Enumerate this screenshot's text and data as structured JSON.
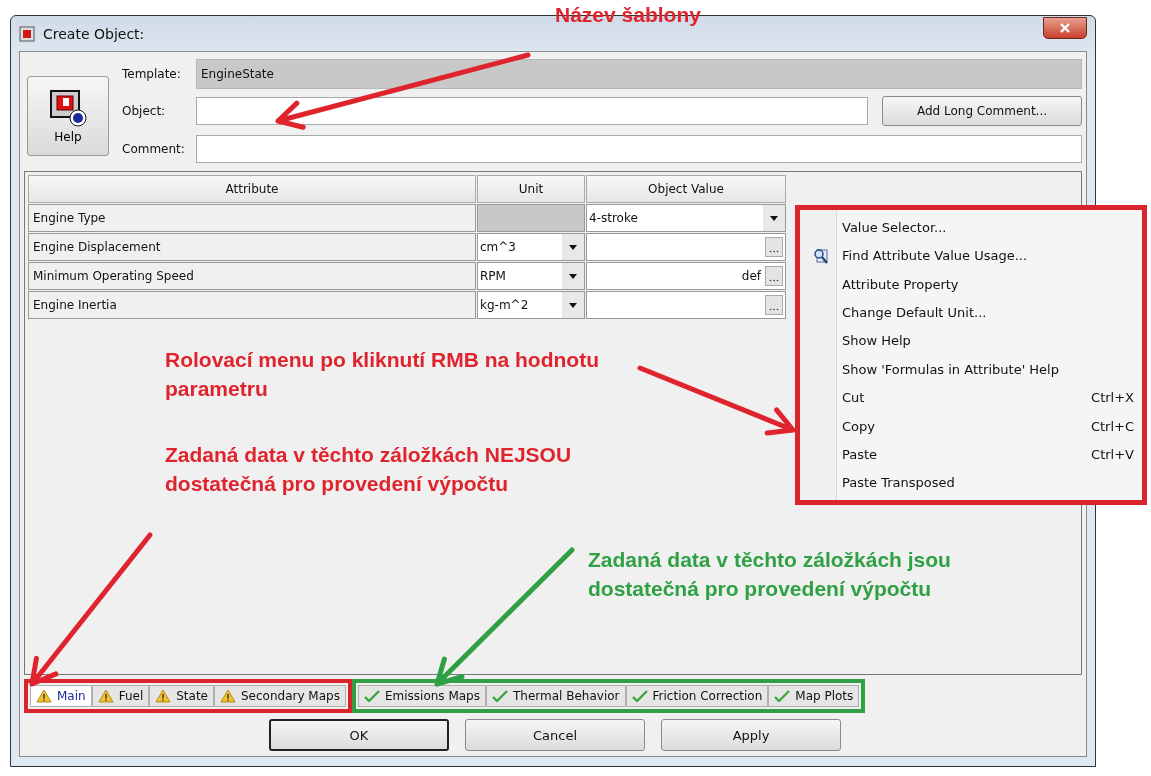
{
  "window": {
    "title": "Create Object:"
  },
  "help_button": {
    "label": "Help"
  },
  "form": {
    "template_label": "Template:",
    "template_value": "EngineState",
    "object_label": "Object:",
    "comment_label": "Comment:",
    "add_comment_button": "Add Long Comment..."
  },
  "table": {
    "columns": [
      "Attribute",
      "Unit",
      "Object Value"
    ],
    "rows": [
      {
        "attribute": "Engine Type",
        "unit": {
          "kind": "empty"
        },
        "value": {
          "kind": "dropdown",
          "text": "4-stroke"
        }
      },
      {
        "attribute": "Engine Displacement",
        "unit": {
          "kind": "dropdown",
          "text": "cm^3"
        },
        "value": {
          "kind": "browse"
        }
      },
      {
        "attribute": "Minimum Operating Speed",
        "unit": {
          "kind": "dropdown",
          "text": "RPM"
        },
        "value": {
          "kind": "browse",
          "text": "def"
        }
      },
      {
        "attribute": "Engine Inertia",
        "unit": {
          "kind": "dropdown",
          "text": "kg-m^2"
        },
        "value": {
          "kind": "browse"
        }
      }
    ]
  },
  "context_menu": [
    {
      "label": "Value Selector...",
      "icon": false
    },
    {
      "label": "Find Attribute Value Usage...",
      "icon": true
    },
    {
      "label": "Attribute Property",
      "icon": false
    },
    {
      "label": "Change Default Unit...",
      "icon": false
    },
    {
      "label": "Show Help",
      "icon": false
    },
    {
      "label": "Show 'Formulas in Attribute' Help",
      "icon": false
    },
    {
      "label": "Cut",
      "shortcut": "Ctrl+X",
      "icon": false
    },
    {
      "label": "Copy",
      "shortcut": "Ctrl+C",
      "icon": false
    },
    {
      "label": "Paste",
      "shortcut": "Ctrl+V",
      "icon": false
    },
    {
      "label": "Paste Transposed",
      "icon": false
    }
  ],
  "tabs": [
    {
      "label": "Main",
      "selected": true,
      "kind": "warning"
    },
    {
      "label": "Fuel",
      "selected": false,
      "kind": "warning"
    },
    {
      "label": "State",
      "selected": false,
      "kind": "warning"
    },
    {
      "label": "Secondary Maps",
      "selected": false,
      "kind": "warning"
    },
    {
      "label": "Emissions Maps",
      "selected": false,
      "kind": "ok"
    },
    {
      "label": "Thermal Behavior",
      "selected": false,
      "kind": "ok"
    },
    {
      "label": "Friction Correction",
      "selected": false,
      "kind": "ok"
    },
    {
      "label": "Map Plots",
      "selected": false,
      "kind": "ok"
    }
  ],
  "buttons": [
    {
      "label": "OK",
      "default": true
    },
    {
      "label": "Cancel",
      "default": false
    },
    {
      "label": "Apply",
      "default": false
    }
  ],
  "annotations": [
    {
      "text": "Název šablony",
      "color": "#e0242e"
    },
    {
      "text": "Rolovací menu po kliknutí RMB na hodnotu parametru",
      "color": "#e0242e"
    },
    {
      "text": "Zadaná data v těchto záložkách NEJSOU dostatečná pro provedení výpočtu",
      "color": "#e0242e"
    },
    {
      "text": "Zadaná data v těchto záložkách jsou dostatečná pro provedení výpočtu",
      "color": "#2fa043"
    }
  ]
}
